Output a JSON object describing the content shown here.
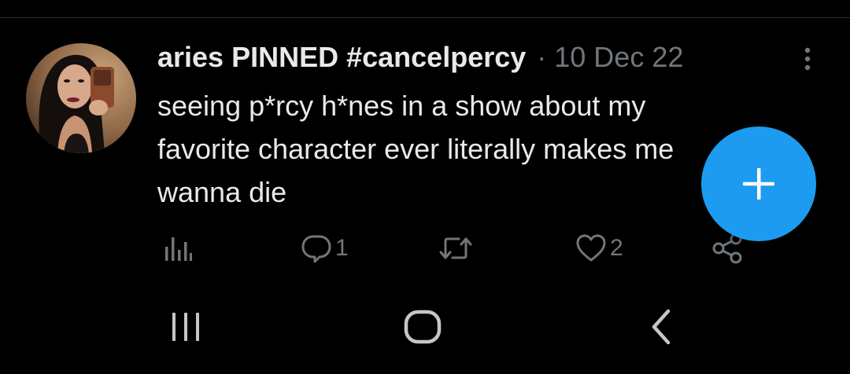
{
  "tweet": {
    "display_name": "aries PINNED #cancelpercy",
    "separator": "·",
    "timestamp": "10 Dec 22",
    "text": "seeing p*rcy h*nes in a show about my favorite character ever literally makes me wanna die",
    "avatar_icon": "profile-photo",
    "more_icon": "vertical-dots-icon"
  },
  "actions": {
    "views": {
      "icon": "analytics-icon",
      "count": ""
    },
    "reply": {
      "icon": "reply-icon",
      "count": "1"
    },
    "retweet": {
      "icon": "retweet-icon",
      "count": ""
    },
    "like": {
      "icon": "heart-icon",
      "count": "2"
    },
    "share": {
      "icon": "share-icon",
      "count": ""
    }
  },
  "compose_button": {
    "icon": "plus-icon",
    "color": "#1d9bf0"
  },
  "system_nav": {
    "recents_icon": "recents-icon",
    "home_icon": "home-icon",
    "back_icon": "back-icon"
  },
  "colors": {
    "background": "#000000",
    "text_primary": "#e7e9ea",
    "text_secondary": "#71767b",
    "accent": "#1d9bf0"
  }
}
